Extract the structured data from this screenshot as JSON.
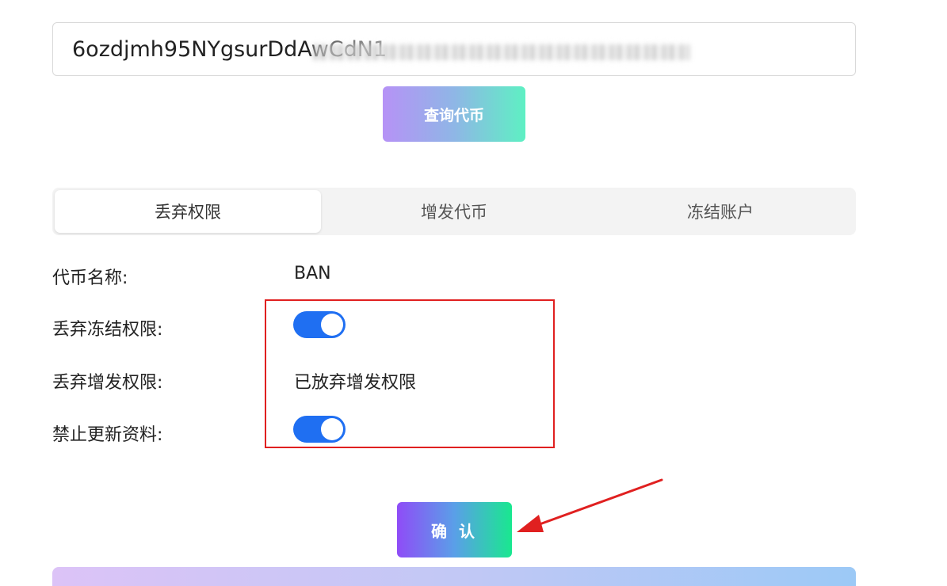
{
  "address_input": {
    "value": "6ozdjmh95NYgsurDdAwCdN1"
  },
  "query_button": {
    "label": "查询代币"
  },
  "tabs": [
    {
      "label": "丢弃权限",
      "active": true
    },
    {
      "label": "增发代币",
      "active": false
    },
    {
      "label": "冻结账户",
      "active": false
    }
  ],
  "form": {
    "token_name_label": "代币名称:",
    "token_name_value": "BAN",
    "freeze_label": "丢弃冻结权限:",
    "freeze_enabled": true,
    "mint_label": "丢弃增发权限:",
    "mint_value": "已放弃增发权限",
    "update_label": "禁止更新资料:",
    "update_enabled": true
  },
  "confirm_button": {
    "label": "确 认"
  },
  "colors": {
    "switch_on": "#1f6ff2",
    "highlight": "#e02020",
    "query_gradient": [
      "#b692f6",
      "#5ef0c3"
    ],
    "confirm_gradient": [
      "#8f4cf7",
      "#19e88f"
    ]
  }
}
